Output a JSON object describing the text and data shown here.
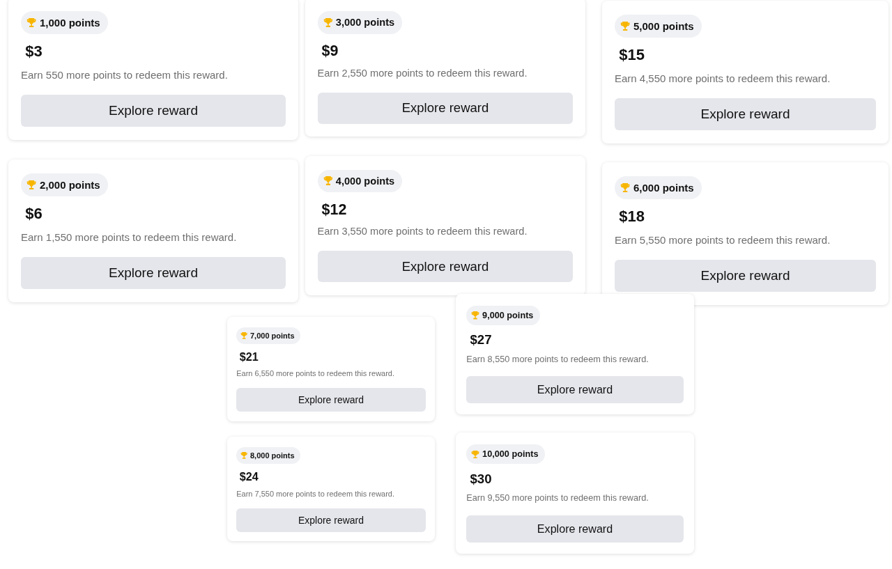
{
  "columns": [
    {
      "cards": [
        {
          "points": "1,000 points",
          "price": "$3",
          "note": "Earn 550 more points to redeem this reward.",
          "button": "Explore reward"
        },
        {
          "points": "2,000 points",
          "price": "$6",
          "note": "Earn 1,550 more points to redeem this reward.",
          "button": "Explore reward"
        }
      ]
    },
    {
      "cards": [
        {
          "points": "3,000 points",
          "price": "$9",
          "note": "Earn 2,550 more points to redeem this reward.",
          "button": "Explore reward"
        },
        {
          "points": "4,000 points",
          "price": "$12",
          "note": "Earn 3,550 more points to redeem this reward.",
          "button": "Explore reward"
        }
      ]
    },
    {
      "cards": [
        {
          "points": "5,000 points",
          "price": "$15",
          "note": "Earn 4,550 more points to redeem this reward.",
          "button": "Explore reward"
        },
        {
          "points": "6,000 points",
          "price": "$18",
          "note": "Earn 5,550 more points to redeem this reward.",
          "button": "Explore reward"
        }
      ]
    },
    {
      "cards": [
        {
          "points": "7,000 points",
          "price": "$21",
          "note": "Earn 6,550 more points to redeem this reward.",
          "button": "Explore reward"
        },
        {
          "points": "8,000 points",
          "price": "$24",
          "note": "Earn 7,550 more points to redeem this reward.",
          "button": "Explore reward"
        }
      ]
    },
    {
      "cards": [
        {
          "points": "9,000 points",
          "price": "$27",
          "note": "Earn 8,550 more points to redeem this reward.",
          "button": "Explore reward"
        },
        {
          "points": "10,000 points",
          "price": "$30",
          "note": "Earn 9,550 more points to redeem this reward.",
          "button": "Explore reward"
        }
      ]
    }
  ]
}
